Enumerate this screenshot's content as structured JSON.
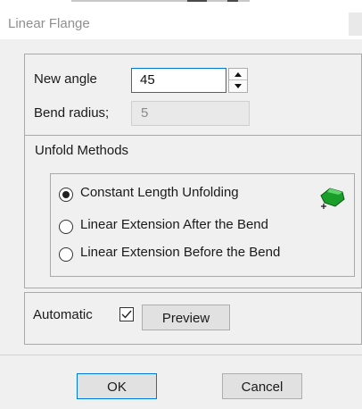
{
  "window": {
    "title": "Linear Flange"
  },
  "angle": {
    "label": "New angle",
    "value": "45"
  },
  "radius": {
    "label": "Bend radius;",
    "value": "5"
  },
  "unfold": {
    "legend": "Unfold Methods",
    "options": [
      {
        "label": "Constant Length Unfolding",
        "checked": true
      },
      {
        "label": "Linear Extension After the Bend",
        "checked": false
      },
      {
        "label": "Linear Extension Before the Bend",
        "checked": false
      }
    ]
  },
  "options_row": {
    "automatic_label": "Automatic",
    "automatic_checked": true,
    "preview_label": "Preview"
  },
  "footer": {
    "ok_label": "OK",
    "cancel_label": "Cancel"
  },
  "colors": {
    "accent": "#0078d7",
    "icon_green": "#1a9e2a"
  }
}
